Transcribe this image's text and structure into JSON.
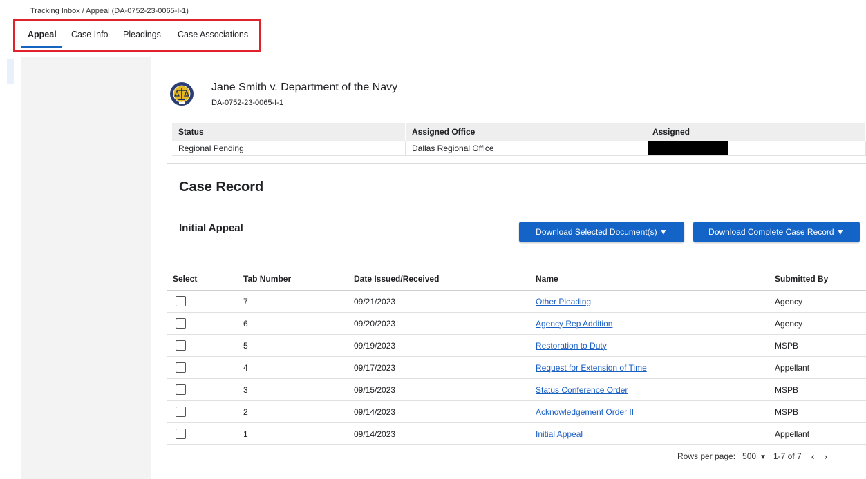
{
  "breadcrumb": "Tracking Inbox / Appeal (DA-0752-23-0065-I-1)",
  "tabs": [
    {
      "label": "Appeal",
      "active": true
    },
    {
      "label": "Case Info",
      "active": false
    },
    {
      "label": "Pleadings",
      "active": false
    },
    {
      "label": "Case Associations",
      "active": false
    }
  ],
  "case": {
    "title": "Jane Smith v. Department of the Navy",
    "number": "DA-0752-23-0065-I-1",
    "info_headers": [
      "Status",
      "Assigned Office",
      "Assigned"
    ],
    "info_values": [
      "Regional Pending",
      "Dallas Regional Office",
      ""
    ]
  },
  "section": {
    "heading": "Case Record",
    "subheading": "Initial Appeal"
  },
  "buttons": {
    "download_selected": "Download Selected Document(s) ▼",
    "download_complete": "Download Complete Case Record ▼"
  },
  "table": {
    "headers": [
      "Select",
      "Tab Number",
      "Date Issued/Received",
      "Name",
      "Submitted By"
    ],
    "rows": [
      {
        "tab": "7",
        "date": "09/21/2023",
        "name": "Other Pleading",
        "by": "Agency"
      },
      {
        "tab": "6",
        "date": "09/20/2023",
        "name": "Agency Rep Addition",
        "by": "Agency"
      },
      {
        "tab": "5",
        "date": "09/19/2023",
        "name": "Restoration to Duty",
        "by": "MSPB"
      },
      {
        "tab": "4",
        "date": "09/17/2023",
        "name": "Request for Extension of Time",
        "by": "Appellant"
      },
      {
        "tab": "3",
        "date": "09/15/2023",
        "name": "Status Conference Order",
        "by": "MSPB"
      },
      {
        "tab": "2",
        "date": "09/14/2023",
        "name": "Acknowledgement Order II",
        "by": "MSPB"
      },
      {
        "tab": "1",
        "date": "09/14/2023",
        "name": "Initial Appeal",
        "by": "Appellant"
      }
    ]
  },
  "pager": {
    "label": "Rows per page:",
    "value": "500",
    "range": "1-7 of 7",
    "prev": "‹",
    "next": "›"
  },
  "colors": {
    "accent": "#1464c8",
    "highlight_box": "#e0232b",
    "link": "#1a5fc4"
  },
  "icons": [
    "mspb-seal-logo",
    "chevron-down-icon",
    "chevron-left-icon",
    "chevron-right-icon"
  ]
}
